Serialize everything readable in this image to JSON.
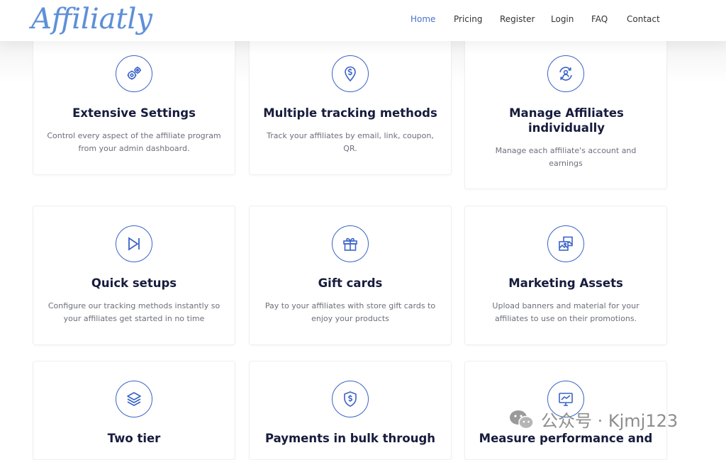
{
  "header": {
    "logo": "Affiliatly",
    "nav": [
      {
        "label": "Home",
        "active": true
      },
      {
        "label": "Pricing"
      },
      {
        "label": "Register"
      },
      {
        "label": "Login"
      },
      {
        "label": "FAQ"
      },
      {
        "label": "Contact"
      }
    ]
  },
  "features": [
    {
      "icon": "gears-icon",
      "title": "Extensive Settings",
      "desc": "Control every aspect of the affiliate program from your admin dashboard."
    },
    {
      "icon": "location-pin-dollar-icon",
      "title": "Multiple tracking methods",
      "desc": "Track your affiliates by email, link, coupon, QR."
    },
    {
      "icon": "user-refresh-icon",
      "title": "Manage Affiliates individually",
      "desc": "Manage each affiliate's account and earnings"
    },
    {
      "icon": "skip-forward-icon",
      "title": "Quick setups",
      "desc": "Configure our tracking methods instantly so your affiliates get started in no time"
    },
    {
      "icon": "gift-icon",
      "title": "Gift cards",
      "desc": "Pay to your affiliates with store gift cards to enjoy your products"
    },
    {
      "icon": "images-icon",
      "title": "Marketing Assets",
      "desc": "Upload banners and material for your affiliates to use on their promotions."
    },
    {
      "icon": "layers-icon",
      "title": "Two tier",
      "desc": ""
    },
    {
      "icon": "shield-dollar-icon",
      "title": "Payments in bulk through",
      "desc": ""
    },
    {
      "icon": "monitor-chart-icon",
      "title": "Measure performance and",
      "desc": ""
    }
  ],
  "watermark": {
    "text": "公众号 · Kjmj123",
    "icon": "wechat-icon"
  }
}
